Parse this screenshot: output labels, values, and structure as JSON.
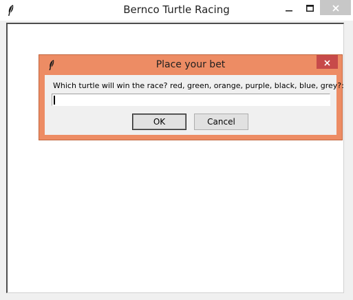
{
  "window": {
    "title": "Bernco Turtle Racing",
    "app_icon": "feather-icon",
    "controls": {
      "minimize_icon": "minimize-icon",
      "maximize_icon": "maximize-icon",
      "close_icon": "close-icon"
    }
  },
  "dialog": {
    "title": "Place your bet",
    "icon": "feather-icon",
    "close_icon": "close-icon",
    "prompt": "Which turtle will win the race? red, green, orange, purple, black, blue, grey?:",
    "input_value": "",
    "ok_label": "OK",
    "cancel_label": "Cancel",
    "colors": {
      "frame": "#ed8c64",
      "close_button": "#c74a4a"
    }
  }
}
